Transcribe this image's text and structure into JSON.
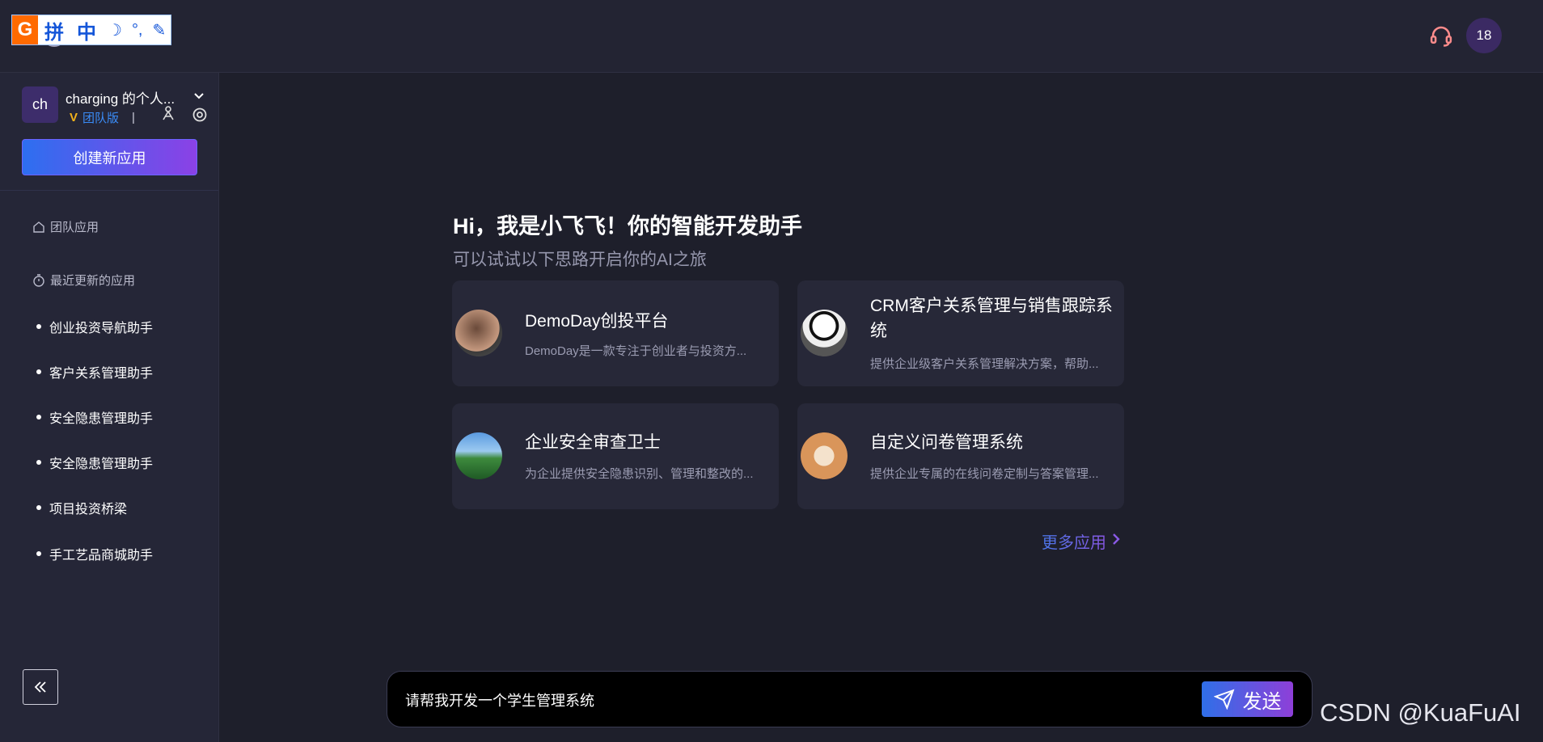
{
  "ime_toolbar": {
    "logo": "G",
    "items": [
      "拼",
      "中"
    ]
  },
  "header": {
    "user_badge": "18"
  },
  "sidebar": {
    "team_avatar": "ch",
    "team_name": "charging 的个人...",
    "edition": "团队版",
    "separator": "|",
    "create_button": "创建新应用",
    "sections": {
      "team_apps": "团队应用",
      "recent_apps": "最近更新的应用"
    },
    "recent_items": [
      "创业投资导航助手",
      "客户关系管理助手",
      "安全隐患管理助手",
      "安全隐患管理助手",
      "项目投资桥梁",
      "手工艺品商城助手"
    ]
  },
  "main": {
    "title": "Hi，我是小飞飞！你的智能开发助手",
    "subtitle": "可以试试以下思路开启你的AI之旅",
    "cards": [
      {
        "title": "DemoDay创投平台",
        "desc": "DemoDay是一款专注于创业者与投资方..."
      },
      {
        "title": "CRM客户关系管理与销售跟踪系统",
        "desc": "提供企业级客户关系管理解决方案，帮助..."
      },
      {
        "title": "企业安全审查卫士",
        "desc": "为企业提供安全隐患识别、管理和整改的..."
      },
      {
        "title": "自定义问卷管理系统",
        "desc": "提供企业专属的在线问卷定制与答案管理..."
      }
    ],
    "more_link": "更多应用"
  },
  "input": {
    "value": "请帮我开发一个学生管理系统",
    "send_label": "发送"
  },
  "watermark": "CSDN @KuaFuAI"
}
